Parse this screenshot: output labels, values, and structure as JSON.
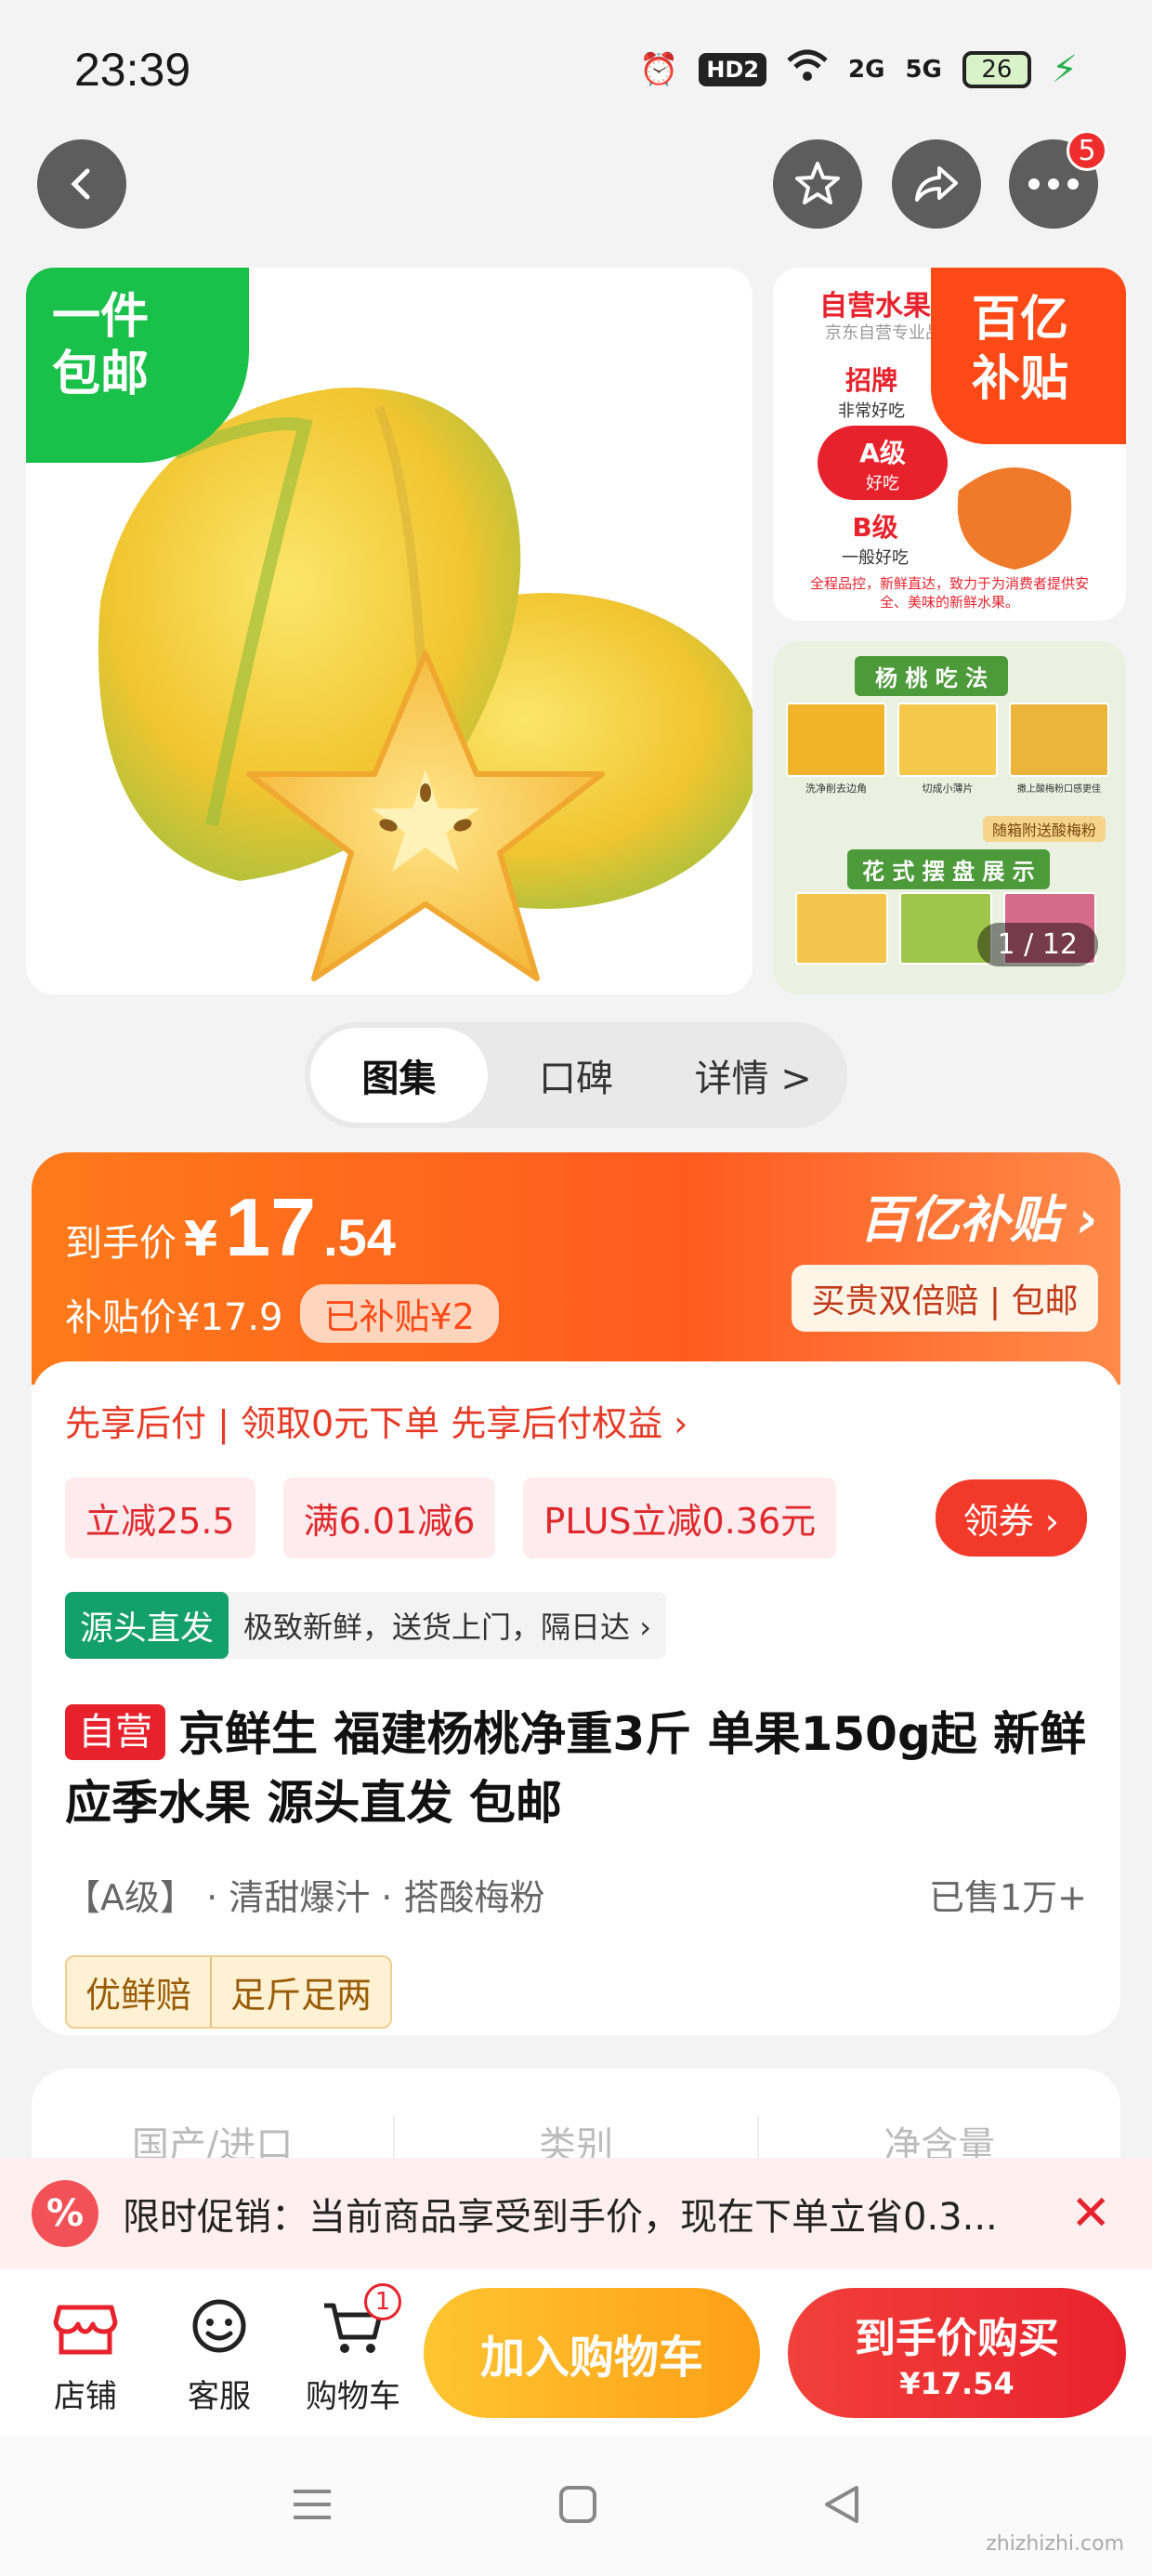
{
  "status_bar": {
    "time": "23:39",
    "hd_label": "HD2",
    "signal_2g": "2G",
    "signal_5g": "5G",
    "battery": "26"
  },
  "nav": {
    "more_badge": "5"
  },
  "gallery": {
    "ship_tag_line1": "一件",
    "ship_tag_line2": "包邮",
    "thumb1_heading": "自营水果品",
    "thumb1_sub": "京东自营专业品",
    "grade_top": "招牌",
    "grade_top_sub": "非常好吃",
    "grade_a": "A级",
    "grade_a_sub": "好吃",
    "grade_b": "B级",
    "grade_b_sub": "一般好吃",
    "thumb1_footer": "全程品控，新鲜直达，致力于为消费者提供安全、美味的新鲜水果。",
    "subsidy_corner_line1": "百亿",
    "subsidy_corner_line2": "补贴",
    "thumb2_heading": "杨 桃 吃 法",
    "thumb2_step1": "洗净削去边角",
    "thumb2_step2": "切成小薄片",
    "thumb2_step3": "撒上酸梅粉口感更佳",
    "thumb2_gift": "随箱附送酸梅粉",
    "thumb2_heading2": "花 式 摆 盘 展 示",
    "counter": "1 / 12"
  },
  "tabs": [
    {
      "label": "图集",
      "active": true
    },
    {
      "label": "口碑",
      "active": false
    },
    {
      "label": "详情 >",
      "active": false
    }
  ],
  "price": {
    "final_label": "到手价",
    "currency": "¥",
    "integer": "17",
    "decimal": ".54",
    "subsidy_price": "补贴价¥17.9",
    "subsidy_pill": "已补贴¥2",
    "brand": "百亿补贴 ›",
    "brand_sub": "买贵双倍赔 | 包邮"
  },
  "paylater": "先享后付 | 领取0元下单 先享后付权益 ›",
  "coupons": [
    "立减25.5",
    "满6.01减6",
    "PLUS立减0.36元"
  ],
  "get_coupon": "领券 ›",
  "direct": {
    "tag": "源头直发",
    "text": "极致新鲜，送货上门，隔日达 ›"
  },
  "product": {
    "self_tag": "自营",
    "title": "京鲜生 福建杨桃净重3斤 单果150g起 新鲜应季水果 源头直发 包邮",
    "attrs": "【A级】 · 清甜爆汁 · 搭酸梅粉",
    "sold": "已售1万+",
    "badge1": "优鲜赔",
    "badge2": "足斤足两"
  },
  "specs": [
    "国产/进口",
    "类别",
    "净含量"
  ],
  "promo": {
    "icon": "%",
    "text": "限时促销：当前商品享受到手价，现在下单立省0.3..."
  },
  "bottom_bar": {
    "store": "店铺",
    "service": "客服",
    "cart": "购物车",
    "cart_badge": "1",
    "add_cart": "加入购物车",
    "buy_line1": "到手价购买",
    "buy_line2": "¥17.54"
  },
  "watermark": "zhizhizhi.com",
  "colors": {
    "brand_orange": "#ff5b1f",
    "buy_red": "#e8222d",
    "cart_yellow": "#ffb320",
    "green_tag": "#19c04a"
  }
}
